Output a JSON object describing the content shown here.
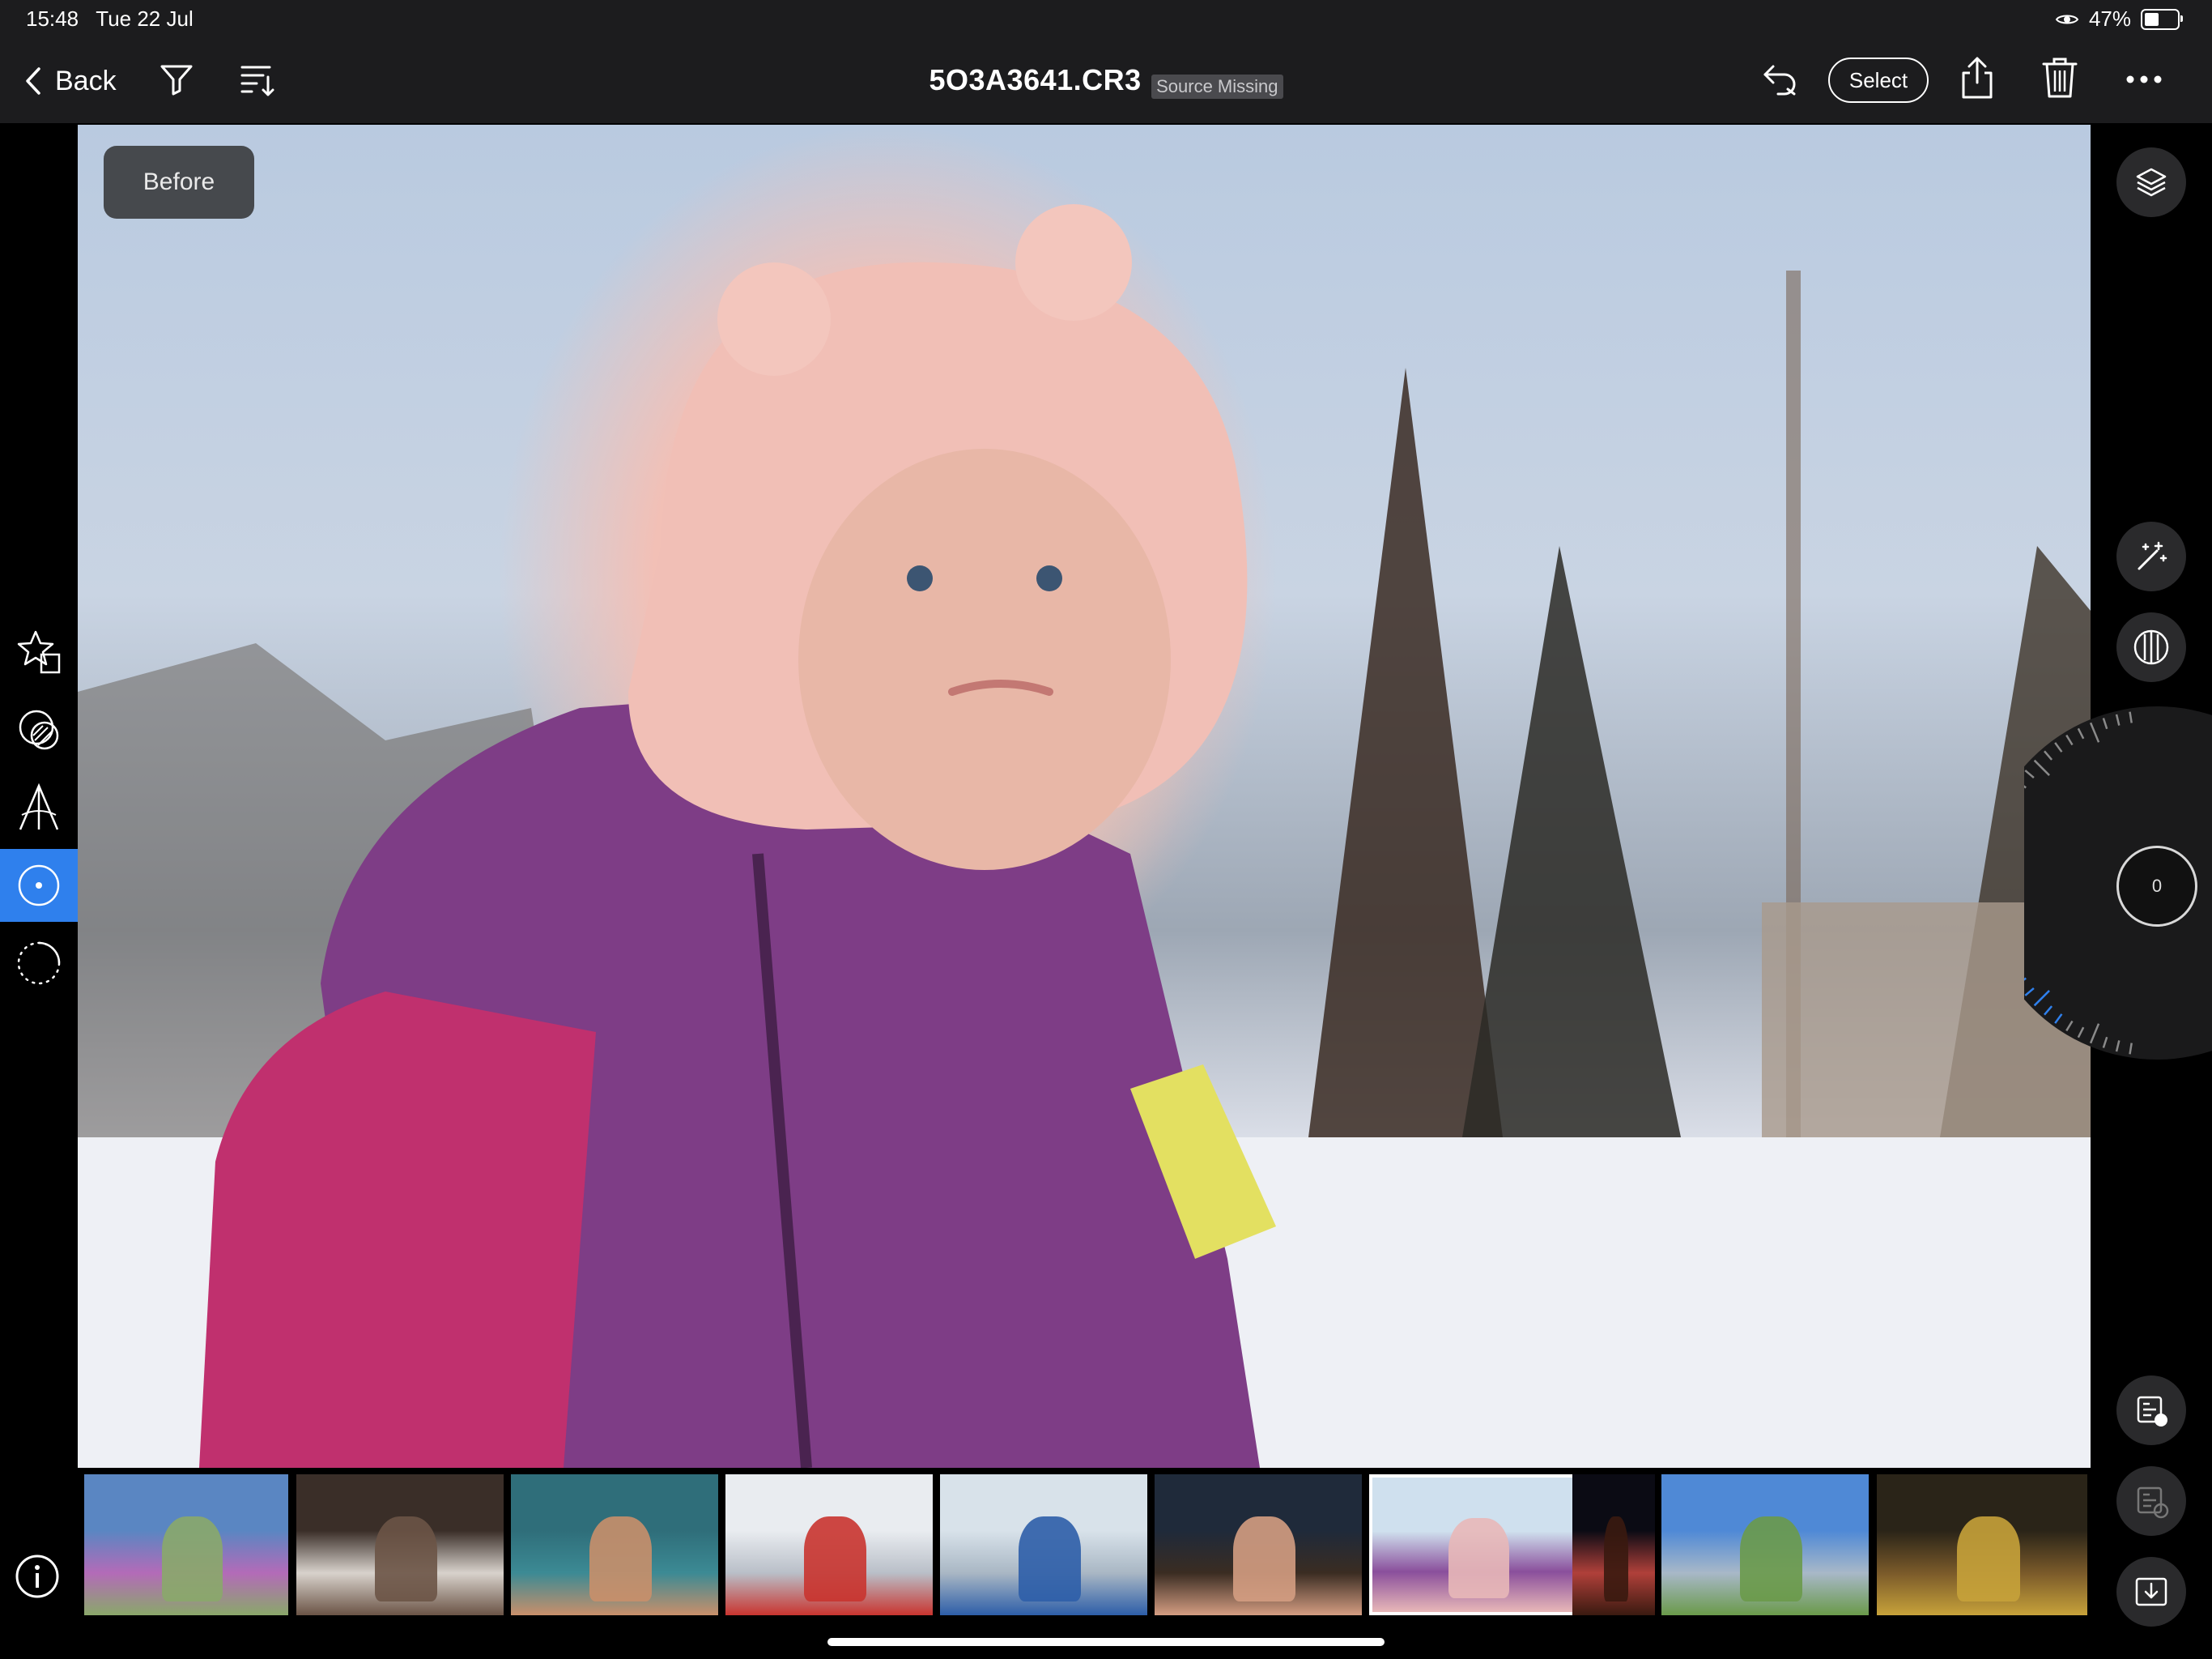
{
  "status": {
    "time": "15:48",
    "date": "Tue 22 Jul",
    "battery": "47%",
    "battery_level": 0.47
  },
  "toolbar": {
    "back_label": "Back",
    "filename": "5O3A3641.CR3",
    "source_badge": "Source Missing",
    "select_label": "Select",
    "icons": [
      "chevron-left-icon",
      "filter-icon",
      "sort-icon",
      "undo-icon",
      "share-icon",
      "trash-icon",
      "more-icon"
    ]
  },
  "photo": {
    "before_label": "Before"
  },
  "left_tools": [
    {
      "name": "presets-tool",
      "icon": "star-square-icon",
      "active": false
    },
    {
      "name": "masking-tool",
      "icon": "mask-icon",
      "active": false
    },
    {
      "name": "geometry-tool",
      "icon": "geometry-icon",
      "active": false
    },
    {
      "name": "optics-tool",
      "icon": "lens-icon",
      "active": true
    },
    {
      "name": "effects-tool",
      "icon": "vignette-icon",
      "active": false
    }
  ],
  "right_tools": [
    "layers-icon",
    "auto-icon",
    "profile-icon",
    "copy-settings-icon",
    "paste-settings-icon",
    "export-icon"
  ],
  "dial": {
    "value": "0"
  },
  "filmstrip": {
    "selected_index": 6,
    "thumbs": [
      {
        "name": "mountain-meadow",
        "colors": [
          "#5a86c2",
          "#8aa86a",
          "#b36bb8"
        ]
      },
      {
        "name": "wedding-couple",
        "colors": [
          "#3a2e28",
          "#6b5446",
          "#d8d2cc"
        ]
      },
      {
        "name": "boy-in-pool",
        "colors": [
          "#2f6e7a",
          "#c98f6a",
          "#3c8a94"
        ]
      },
      {
        "name": "child-red-snowsuit",
        "colors": [
          "#e9ecf0",
          "#c9342f",
          "#b9bfc8"
        ]
      },
      {
        "name": "boy-throwing-snow",
        "colors": [
          "#d8e2ea",
          "#2d5ea8",
          "#a9b7c4"
        ]
      },
      {
        "name": "smiling-girl",
        "colors": [
          "#1f2a3a",
          "#d49d82",
          "#3a2c22"
        ]
      },
      {
        "name": "girl-pink-hat",
        "colors": [
          "#cfe0ee",
          "#e8b8b8",
          "#8a4f9c"
        ]
      },
      {
        "name": "night-street",
        "colors": [
          "#0b0b14",
          "#3a1a10",
          "#b0403a"
        ]
      },
      {
        "name": "river-park",
        "colors": [
          "#4f89d6",
          "#6a9a4a",
          "#a8b8c8"
        ]
      },
      {
        "name": "market-stall",
        "colors": [
          "#2a2418",
          "#c7a23a",
          "#7a5a2a"
        ]
      }
    ]
  }
}
